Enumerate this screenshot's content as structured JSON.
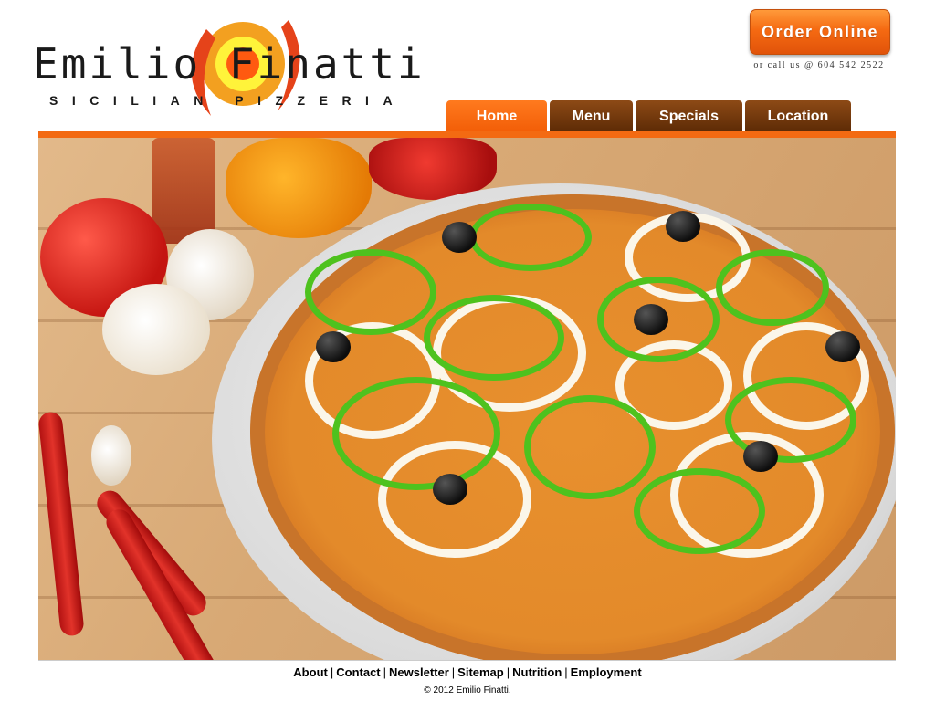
{
  "logo": {
    "name": "Emilio Finatti",
    "tagline": "SICILIAN PIZZERIA"
  },
  "order": {
    "button_label": "Order Online",
    "call_text": "or call us @ 604 542 2522"
  },
  "nav": {
    "tabs": [
      {
        "label": "Home",
        "active": true
      },
      {
        "label": "Menu",
        "active": false
      },
      {
        "label": "Specials",
        "active": false
      },
      {
        "label": "Location",
        "active": false
      }
    ]
  },
  "footer": {
    "links": [
      "About",
      "Contact",
      "Newsletter",
      "Sitemap",
      "Nutrition",
      "Employment"
    ],
    "copyright": "© 2012 Emilio Finatti."
  },
  "colors": {
    "accent": "#f36a12",
    "nav_inactive": "#6b3a10",
    "text": "#1a1a1a"
  }
}
